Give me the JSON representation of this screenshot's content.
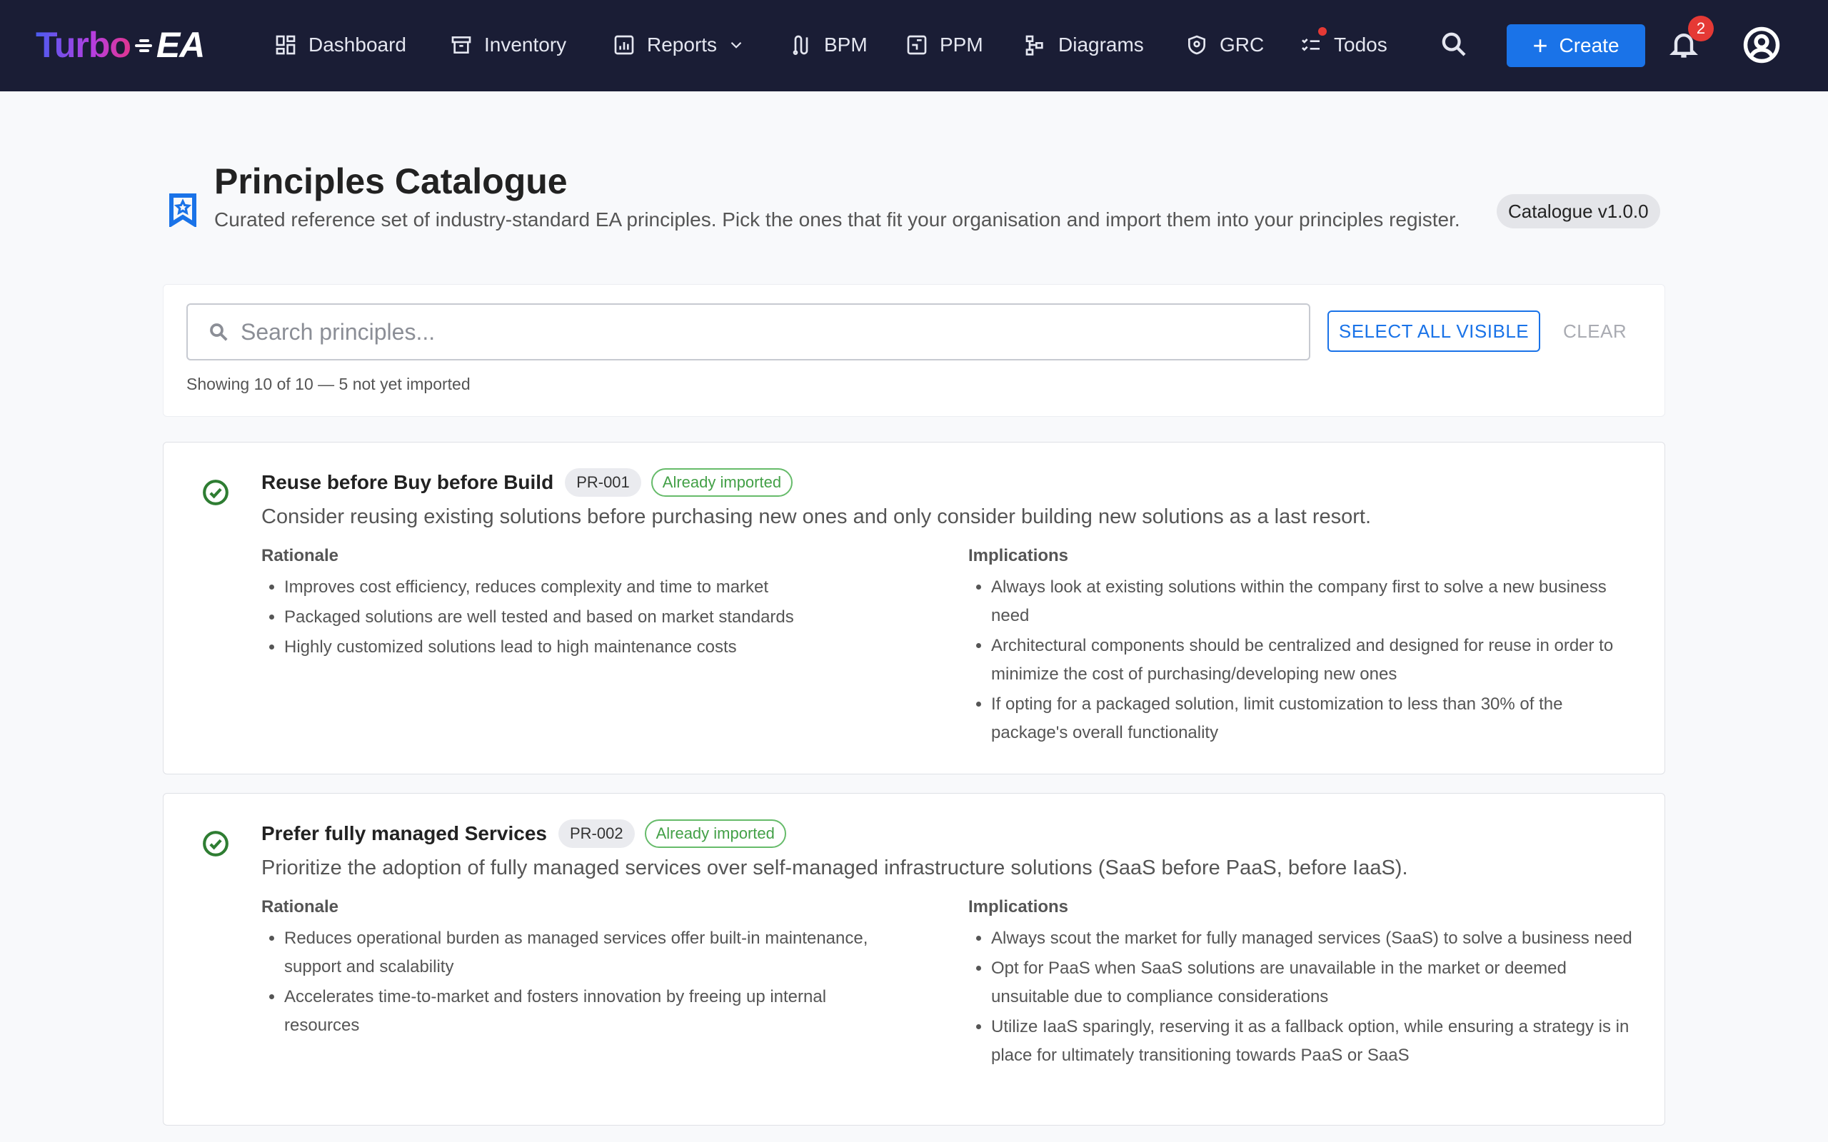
{
  "app": {
    "logo_left": "Turbo",
    "logo_right": "EA"
  },
  "nav": [
    {
      "label": "Dashboard",
      "icon": "dashboard-icon"
    },
    {
      "label": "Inventory",
      "icon": "inventory-icon"
    },
    {
      "label": "Reports",
      "icon": "reports-icon"
    },
    {
      "label": "BPM",
      "icon": "bpm-icon"
    },
    {
      "label": "PPM",
      "icon": "ppm-icon"
    },
    {
      "label": "Diagrams",
      "icon": "diagrams-icon"
    },
    {
      "label": "GRC",
      "icon": "grc-icon"
    },
    {
      "label": "Todos",
      "icon": "todos-icon"
    }
  ],
  "toolbar": {
    "create_label": "Create",
    "notification_count": "2"
  },
  "header": {
    "title": "Principles Catalogue",
    "subtitle": "Curated reference set of industry-standard EA principles. Pick the ones that fit your organisation and import them into your principles register.",
    "version": "Catalogue v1.0.0"
  },
  "filter": {
    "search_placeholder": "Search principles...",
    "select_all_label": "SELECT ALL VISIBLE",
    "clear_label": "CLEAR",
    "count_text": "Showing 10 of 10 — 5 not yet imported"
  },
  "colors": {
    "topbar": "#1a1d35",
    "accent": "#1a73e8",
    "success": "#43a047",
    "badge": "#e53935"
  },
  "principles": [
    {
      "name": "Reuse before Buy before Build",
      "code": "PR-001",
      "status": "Already imported",
      "description": "Consider reusing existing solutions before purchasing new ones and only consider building new solutions as a last resort.",
      "rationale_title": "Rationale",
      "implications_title": "Implications",
      "rationale": [
        "Improves cost efficiency, reduces complexity and time to market",
        "Packaged solutions are well tested and based on market standards",
        "Highly customized solutions lead to high maintenance costs"
      ],
      "implications": [
        "Always look at existing solutions within the company first to solve a new business need",
        "Architectural components should be centralized and designed for reuse in order to minimize the cost of purchasing/developing new ones",
        "If opting for a packaged solution, limit customization to less than 30% of the package's overall functionality"
      ]
    },
    {
      "name": "Prefer fully managed Services",
      "code": "PR-002",
      "status": "Already imported",
      "description": "Prioritize the adoption of fully managed services over self-managed infrastructure solutions (SaaS before PaaS, before IaaS).",
      "rationale_title": "Rationale",
      "implications_title": "Implications",
      "rationale": [
        "Reduces operational burden as managed services offer built-in maintenance, support and scalability",
        "Accelerates time-to-market and fosters innovation by freeing up internal resources"
      ],
      "implications": [
        "Always scout the market for fully managed services (SaaS) to solve a business need",
        "Opt for PaaS when SaaS solutions are unavailable in the market or deemed unsuitable due to compliance considerations",
        "Utilize IaaS sparingly, reserving it as a fallback option, while ensuring a strategy is in place for ultimately transitioning towards PaaS or SaaS"
      ]
    }
  ]
}
